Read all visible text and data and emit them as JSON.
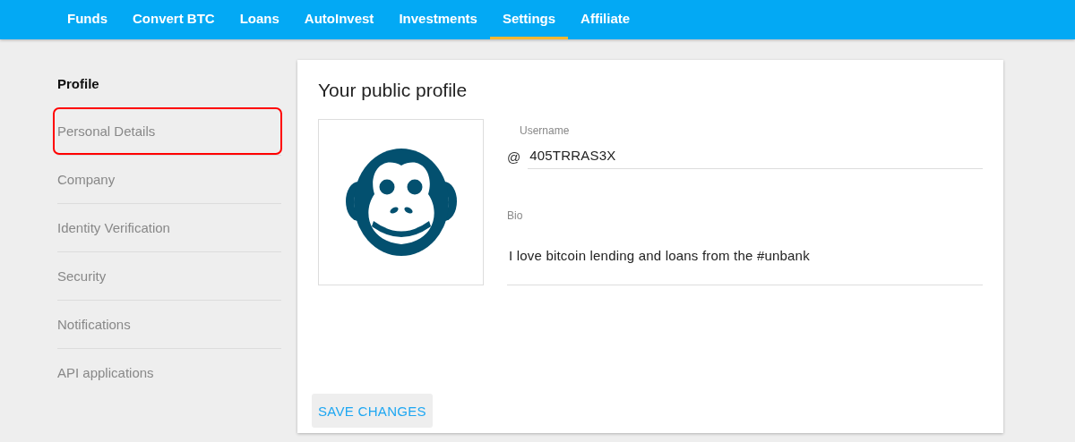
{
  "nav": {
    "items": [
      {
        "label": "Funds",
        "selected": false
      },
      {
        "label": "Convert BTC",
        "selected": false
      },
      {
        "label": "Loans",
        "selected": false
      },
      {
        "label": "AutoInvest",
        "selected": false
      },
      {
        "label": "Investments",
        "selected": false
      },
      {
        "label": "Settings",
        "selected": true
      },
      {
        "label": "Affiliate",
        "selected": false
      }
    ]
  },
  "sidebar": {
    "items": [
      {
        "label": "Profile",
        "selected": true,
        "highlighted": false
      },
      {
        "label": "Personal Details",
        "selected": false,
        "highlighted": true
      },
      {
        "label": "Company",
        "selected": false,
        "highlighted": false
      },
      {
        "label": "Identity Verification",
        "selected": false,
        "highlighted": false
      },
      {
        "label": "Security",
        "selected": false,
        "highlighted": false
      },
      {
        "label": "Notifications",
        "selected": false,
        "highlighted": false
      },
      {
        "label": "API applications",
        "selected": false,
        "highlighted": false
      }
    ]
  },
  "profile": {
    "title": "Your public profile",
    "username": {
      "label": "Username",
      "prefix": "@",
      "value": "405TRRAS3X"
    },
    "bio": {
      "label": "Bio",
      "value": "I love bitcoin lending and loans from the #unbank"
    },
    "save_button": "SAVE CHANGES"
  }
}
